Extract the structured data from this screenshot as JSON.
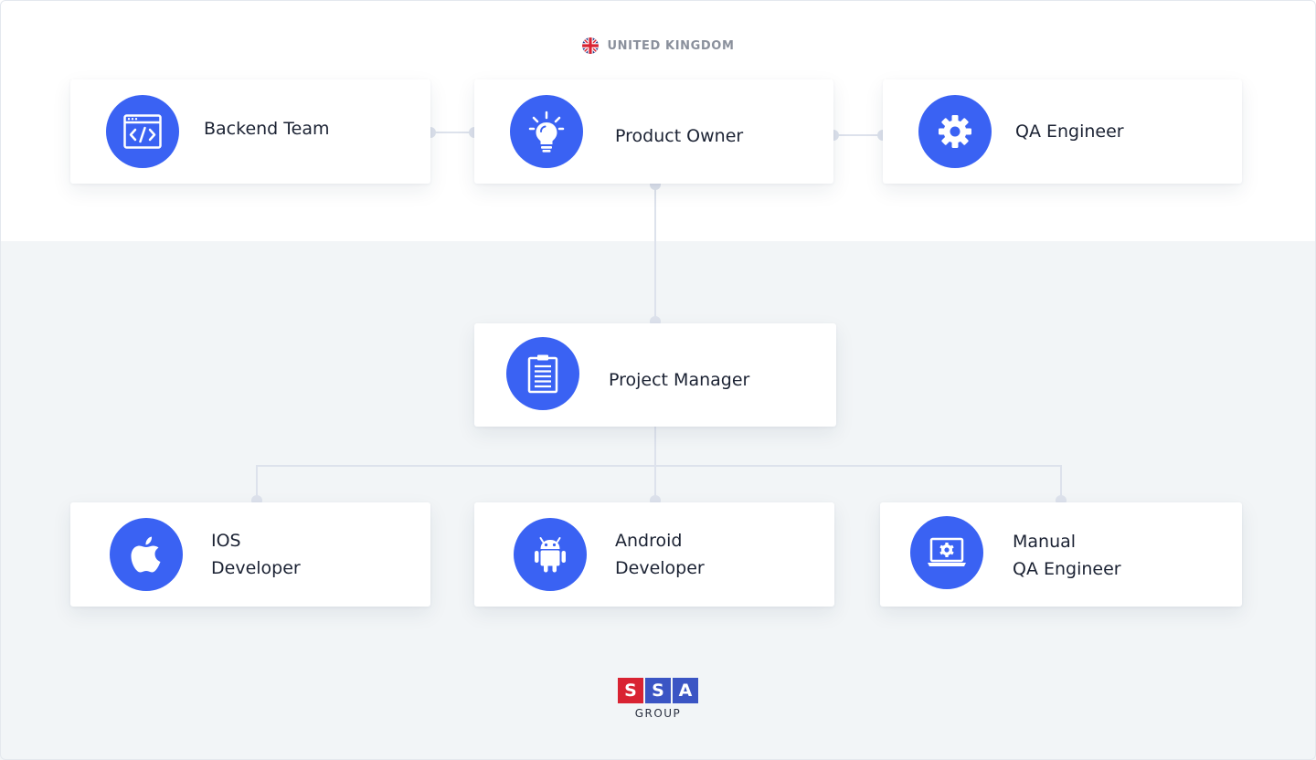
{
  "region": {
    "label": "UNITED KINGDOM",
    "icon": "uk-flag-icon"
  },
  "colors": {
    "accent": "#3a62f3",
    "connector": "#dde2ec",
    "logo_red": "#d92332",
    "logo_blue": "#3b55c4"
  },
  "nodes": {
    "backend": {
      "label": "Backend Team",
      "icon": "code-window-icon"
    },
    "product_owner": {
      "label": "Product Owner",
      "icon": "lightbulb-icon"
    },
    "qa": {
      "label": "QA Engineer",
      "icon": "gear-icon"
    },
    "pm": {
      "label": "Project Manager",
      "icon": "clipboard-icon"
    },
    "ios": {
      "line1": "IOS",
      "line2": "Developer",
      "icon": "apple-icon"
    },
    "android": {
      "line1": "Android",
      "line2": "Developer",
      "icon": "android-icon"
    },
    "manual_qa": {
      "line1": "Manual",
      "line2": "QA Engineer",
      "icon": "laptop-gear-icon"
    }
  },
  "logo": {
    "letters": [
      "S",
      "S",
      "A"
    ],
    "subtitle": "GROUP"
  }
}
